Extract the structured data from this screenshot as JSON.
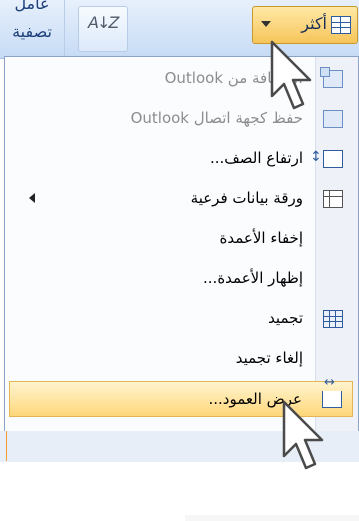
{
  "ribbon": {
    "filter_group": {
      "line1": "عامل",
      "line2": "تصفية"
    },
    "sort_icon": "az-sort-icon",
    "more_button": {
      "label": "أكثر",
      "icon": "table-icon",
      "arrow_icon": "chevron-down-icon"
    }
  },
  "menu": {
    "items": [
      {
        "label": "...إضافة من Outlook",
        "icon": "outlook-add-icon",
        "disabled": true
      },
      {
        "label": "حفظ كجهة اتصال Outlook",
        "icon": "outlook-contact-icon",
        "disabled": true
      },
      {
        "label": "ارتفاع الصف...",
        "icon": "row-height-icon",
        "disabled": false
      },
      {
        "label": "ورقة بيانات فرعية",
        "icon": "subdatasheet-icon",
        "disabled": false,
        "has_submenu": true
      },
      {
        "label": "إخفاء الأعمدة",
        "icon": "",
        "disabled": false
      },
      {
        "label": "إظهار الأعمدة...",
        "icon": "",
        "disabled": false
      },
      {
        "label": "تجميد",
        "icon": "freeze-icon",
        "disabled": false
      },
      {
        "label": "إلغاء تجميد",
        "icon": "",
        "disabled": false
      },
      {
        "label": "عرض العمود...",
        "icon": "column-width-icon",
        "disabled": false,
        "highlighted": true
      }
    ]
  },
  "colors": {
    "highlight": "#ffd77a",
    "ribbon": "#c7dbf5",
    "menu_border": "#8ba3c9"
  }
}
